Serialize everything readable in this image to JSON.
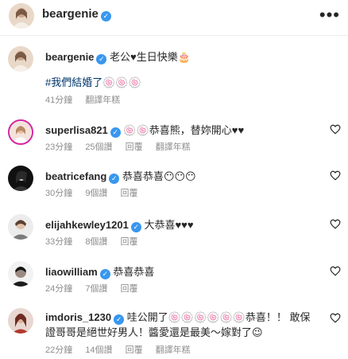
{
  "header": {
    "username": "beargenie",
    "more_icon": "more-horizontal-icon"
  },
  "caption": {
    "username": "beargenie",
    "text": "老公♥生日快樂🎂",
    "hashtag": "#我們結婚了🍥🍥🍥",
    "time": "41分鐘",
    "translate": "翻譯年糕"
  },
  "comments": [
    {
      "username": "superlisa821",
      "text": "🍥🍥恭喜熊，替妳開心♥♥",
      "time": "23分鐘",
      "likes": "25個讚",
      "reply": "回覆",
      "translate": "翻譯年糕"
    },
    {
      "username": "beatricefang",
      "text": "恭喜恭喜😶😶😶",
      "time": "30分鐘",
      "likes": "9個讚",
      "reply": "回覆",
      "translate": ""
    },
    {
      "username": "elijahkewley1201",
      "text": "大恭喜♥♥♥",
      "time": "33分鐘",
      "likes": "8個讚",
      "reply": "回覆",
      "translate": ""
    },
    {
      "username": "liaowilliam",
      "text": "恭喜恭喜",
      "time": "24分鐘",
      "likes": "7個讚",
      "reply": "回覆",
      "translate": ""
    },
    {
      "username": "imdoris_1230",
      "text": "哇公開了🍥🍥🍥🍥🍥🍥恭喜！！ 敢保證哥哥是絕世好男人！醬愛還是最美～嫁對了😉",
      "time": "22分鐘",
      "likes": "14個讚",
      "reply": "回覆",
      "translate": "翻譯年糕"
    }
  ],
  "colors": {
    "verified": "#3897f0",
    "meta": "#8e8e8e",
    "hashtag": "#00376b"
  }
}
